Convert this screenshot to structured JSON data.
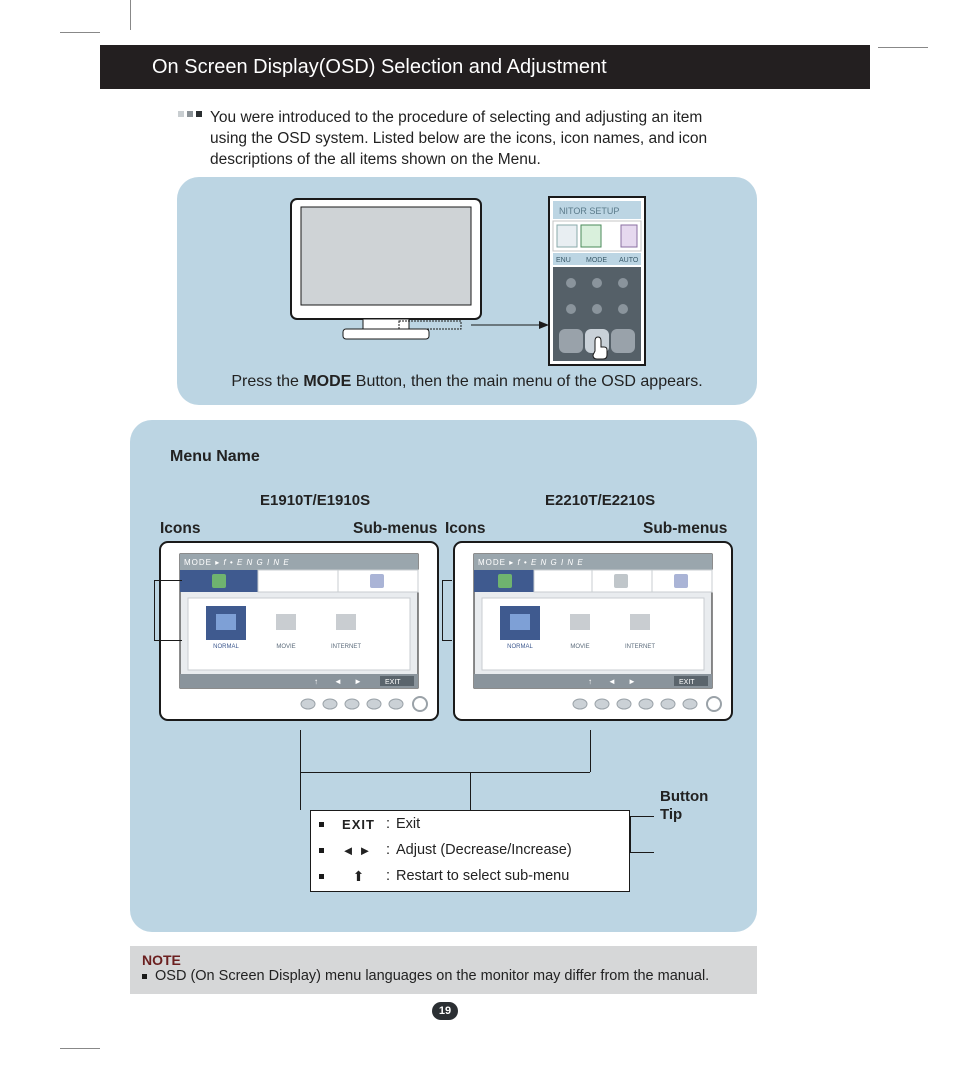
{
  "title": "On Screen Display(OSD) Selection and Adjustment",
  "lead": "You were introduced to the procedure of selecting and adjusting an item using the OSD system. Listed below are the icons, icon names, and icon descriptions of the all items shown on the Menu.",
  "panel1": {
    "instruction_pre": "Press the ",
    "instruction_bold": "MODE",
    "instruction_post": " Button, then the main menu of the OSD appears.",
    "remote": {
      "header": "NITOR SETUP",
      "btn1": "ENU",
      "btn2": "MODE",
      "btn3": "AUTO"
    }
  },
  "panel2": {
    "menu_name": "Menu Name",
    "models": {
      "a": "E1910T/E1910S",
      "b": "E2210T/E2210S"
    },
    "labels": {
      "icons": "Icons",
      "submenus": "Sub-menus",
      "button_tip": "Button\nTip"
    },
    "osd": {
      "mode_title": "MODE",
      "engine": "f • E N G I N E",
      "items": [
        "NORMAL",
        "MOVIE",
        "INTERNET"
      ],
      "exit_btn": "EXIT"
    },
    "tips": {
      "exit_icon": "EXIT",
      "rows": [
        {
          "desc": "Exit"
        },
        {
          "desc": "Adjust (Decrease/Increase)"
        },
        {
          "desc": "Restart to select sub-menu"
        }
      ]
    }
  },
  "note": {
    "title": "NOTE",
    "text": "OSD (On Screen Display) menu languages on the monitor may differ from the manual."
  },
  "page_number": "19"
}
